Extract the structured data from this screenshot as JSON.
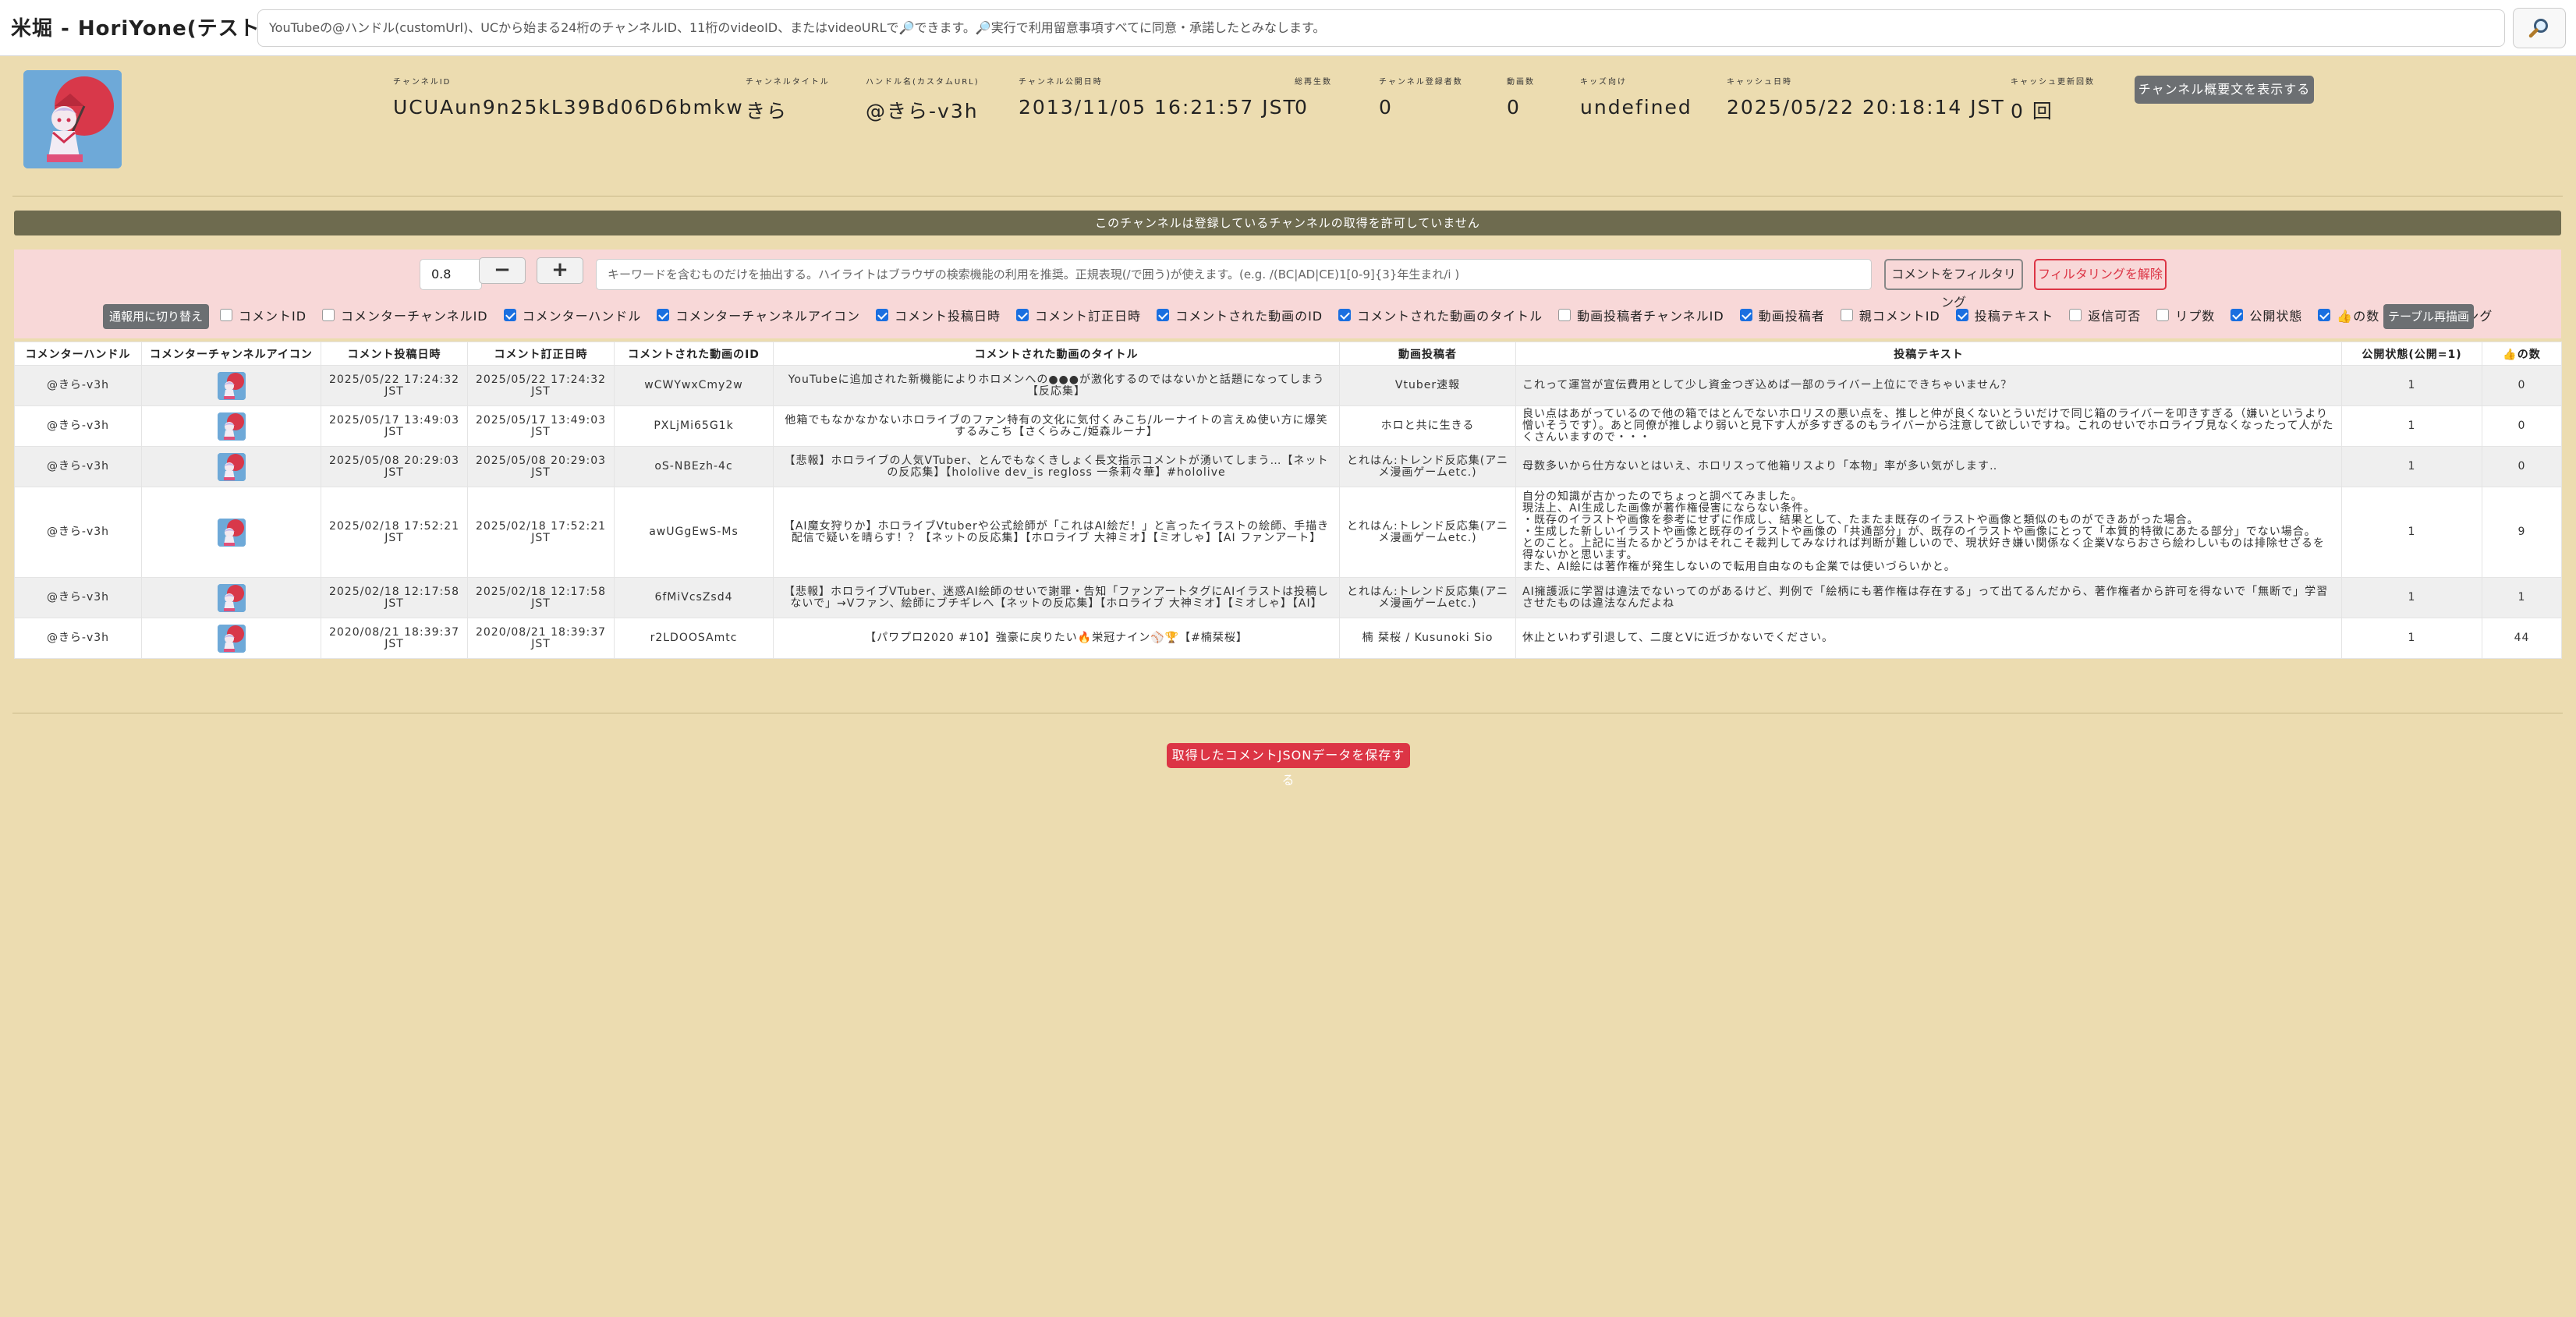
{
  "app": {
    "title": "米堀 - HoriYone(テスト中)"
  },
  "search": {
    "value": "YouTubeの@ハンドル(customUrl)、UCから始まる24桁のチャンネルID、11桁のvideoID、またはvideoURLで🔎できます。🔎実行で利用留意事項すべてに同意・承諾したとみなします。",
    "button_icon": "search-icon"
  },
  "channel": {
    "fields": [
      {
        "label": "チャンネルID",
        "value": "UCUAun9n25kL39Bd06D6bmkw"
      },
      {
        "label": "チャンネルタイトル",
        "value": "きら"
      },
      {
        "label": "ハンドル名(カスタムURL)",
        "value": "@きら-v3h"
      },
      {
        "label": "チャンネル公開日時",
        "value": "2013/11/05 16:21:57 JST"
      },
      {
        "label": "総再生数",
        "value": "0"
      },
      {
        "label": "チャンネル登録者数",
        "value": "0"
      },
      {
        "label": "動画数",
        "value": "0"
      },
      {
        "label": "キッズ向け",
        "value": "undefined"
      },
      {
        "label": "キャッシュ日時",
        "value": "2025/05/22 20:18:14 JST"
      },
      {
        "label": "キャッシュ更新回数",
        "value": "0 回"
      }
    ],
    "overview_button": "チャンネル概要文を表示する"
  },
  "notice": "このチャンネルは登録しているチャンネルの取得を許可していません",
  "filter": {
    "threshold": "0.8",
    "minus": "−",
    "plus": "+",
    "keyword_placeholder": "キーワードを含むものだけを抽出する。ハイライトはブラウザの検索機能の利用を推奨。正規表現(/で囲う)が使えます。(e.g. /(BC|AD|CE)1[0-9]{3}年生まれ/i )",
    "filter_button": "コメントをフィルタリング",
    "clear_button": "フィルタリングを解除",
    "switch_button": "通報用に切り替え",
    "redraw_button": "テーブル再描画",
    "columns": [
      {
        "label": "コメントID",
        "checked": false
      },
      {
        "label": "コメンターチャンネルID",
        "checked": false
      },
      {
        "label": "コメンターハンドル",
        "checked": true
      },
      {
        "label": "コメンターチャンネルアイコン",
        "checked": true
      },
      {
        "label": "コメント投稿日時",
        "checked": true
      },
      {
        "label": "コメント訂正日時",
        "checked": true
      },
      {
        "label": "コメントされた動画のID",
        "checked": true
      },
      {
        "label": "コメントされた動画のタイトル",
        "checked": true
      },
      {
        "label": "動画投稿者チャンネルID",
        "checked": false
      },
      {
        "label": "動画投稿者",
        "checked": true
      },
      {
        "label": "親コメントID",
        "checked": false
      },
      {
        "label": "投稿テキスト",
        "checked": true
      },
      {
        "label": "返信可否",
        "checked": false
      },
      {
        "label": "リプ数",
        "checked": false
      },
      {
        "label": "公開状態",
        "checked": true
      },
      {
        "label": "👍の数",
        "checked": true
      },
      {
        "label": "レーティング",
        "checked": false
      }
    ]
  },
  "table": {
    "headers": [
      "コメンターハンドル",
      "コメンターチャンネルアイコン",
      "コメント投稿日時",
      "コメント訂正日時",
      "コメントされた動画のID",
      "コメントされた動画のタイトル",
      "動画投稿者",
      "投稿テキスト",
      "公開状態(公開=1)",
      "👍の数"
    ],
    "rows": [
      {
        "handle": "@きら-v3h",
        "posted": "2025/05/22 17:24:32 JST",
        "edited": "2025/05/22 17:24:32 JST",
        "video_id": "wCWYwxCmy2w",
        "video_title": "YouTubeに追加された新機能によりホロメンへの●●●が激化するのではないかと話題になってしまう【反応集】",
        "uploader": "Vtuber速報",
        "text": "これって運営が宣伝費用として少し資金つぎ込めば一部のライバー上位にできちゃいません？",
        "public": "1",
        "likes": "0"
      },
      {
        "handle": "@きら-v3h",
        "posted": "2025/05/17 13:49:03 JST",
        "edited": "2025/05/17 13:49:03 JST",
        "video_id": "PXLjMi65G1k",
        "video_title": "他箱でもなかなかないホロライブのファン特有の文化に気付くみこち/ルーナイトの言えぬ使い方に爆笑するみこち【さくらみこ/姫森ルーナ】",
        "uploader": "ホロと共に生きる",
        "text": "良い点はあがっているので他の箱ではとんでないホロリスの悪い点を、推しと仲が良くないとういだけで同じ箱のライバーを叩きすぎる（嫌いというより憎いそうです）。あと同僚が推しより弱いと見下す人が多すぎるのもライバーから注意して欲しいですね。これのせいでホロライブ見なくなったって人がたくさんいますので・・・",
        "public": "1",
        "likes": "0"
      },
      {
        "handle": "@きら-v3h",
        "posted": "2025/05/08 20:29:03 JST",
        "edited": "2025/05/08 20:29:03 JST",
        "video_id": "oS-NBEzh-4c",
        "video_title": "【悲報】ホロライブの人気VTuber、とんでもなくきしょく長文指示コメントが湧いてしまう…【ネットの反応集】【hololive dev_is regloss 一条莉々華】#hololive",
        "uploader": "とれはん:トレンド反応集(アニメ漫画ゲームetc.)",
        "text": "母数多いから仕方ないとはいえ、ホロリスって他箱リスより「本物」率が多い気がします‥",
        "public": "1",
        "likes": "0"
      },
      {
        "handle": "@きら-v3h",
        "posted": "2025/02/18 17:52:21 JST",
        "edited": "2025/02/18 17:52:21 JST",
        "video_id": "awUGgEwS-Ms",
        "video_title": "【AI魔女狩りか】ホロライブVtuberや公式絵師が「これはAI絵だ！」と言ったイラストの絵師、手描き配信で疑いを晴らす！？【ネットの反応集】【ホロライブ 大神ミオ】【ミオしゃ】【AI ファンアート】",
        "uploader": "とれはん:トレンド反応集(アニメ漫画ゲームetc.)",
        "text": "自分の知識が古かったのでちょっと調べてみました。\n現法上、AI生成した画像が著作権侵害にならない条件。\n・既存のイラストや画像を参考にせずに作成し、結果として、たまたま既存のイラストや画像と類似のものができあがった場合。\n・生成した新しいイラストや画像と既存のイラストや画像の「共通部分」が、既存のイラストや画像にとって「本質的特徴にあたる部分」でない場合。\nとのこと。上記に当たるかどうかはそれこそ裁判してみなければ判断が難しいので、現状好き嫌い関係なく企業Vならおさら絵わしいものは排除せざるを得ないかと思います。\nまた、AI絵には著作権が発生しないので転用自由なのも企業では使いづらいかと。",
        "public": "1",
        "likes": "9"
      },
      {
        "handle": "@きら-v3h",
        "posted": "2025/02/18 12:17:58 JST",
        "edited": "2025/02/18 12:17:58 JST",
        "video_id": "6fMiVcsZsd4",
        "video_title": "【悲報】ホロライブVTuber、迷惑AI絵師のせいで謝罪・告知「ファンアートタグにAIイラストは投稿しないで」→Vファン、絵師にブチギレへ【ネットの反応集】【ホロライブ 大神ミオ】【ミオしゃ】【AI】",
        "uploader": "とれはん:トレンド反応集(アニメ漫画ゲームetc.)",
        "text": "AI擁護派に学習は違法でないってのがあるけど、判例で「絵柄にも著作権は存在する」って出てるんだから、著作権者から許可を得ないで「無断で」学習させたものは違法なんだよね",
        "public": "1",
        "likes": "1"
      },
      {
        "handle": "@きら-v3h",
        "posted": "2020/08/21 18:39:37 JST",
        "edited": "2020/08/21 18:39:37 JST",
        "video_id": "r2LDOOSAmtc",
        "video_title": "【パワプロ2020 #10】強豪に戻りたい🔥栄冠ナイン⚾🏆【#楠栞桜】",
        "uploader": "楠 栞桜 / Kusunoki Sio",
        "text": "休止といわず引退して、二度とVに近づかないでください。",
        "public": "1",
        "likes": "44"
      }
    ]
  },
  "save_button": "取得したコメントJSONデータを保存する"
}
